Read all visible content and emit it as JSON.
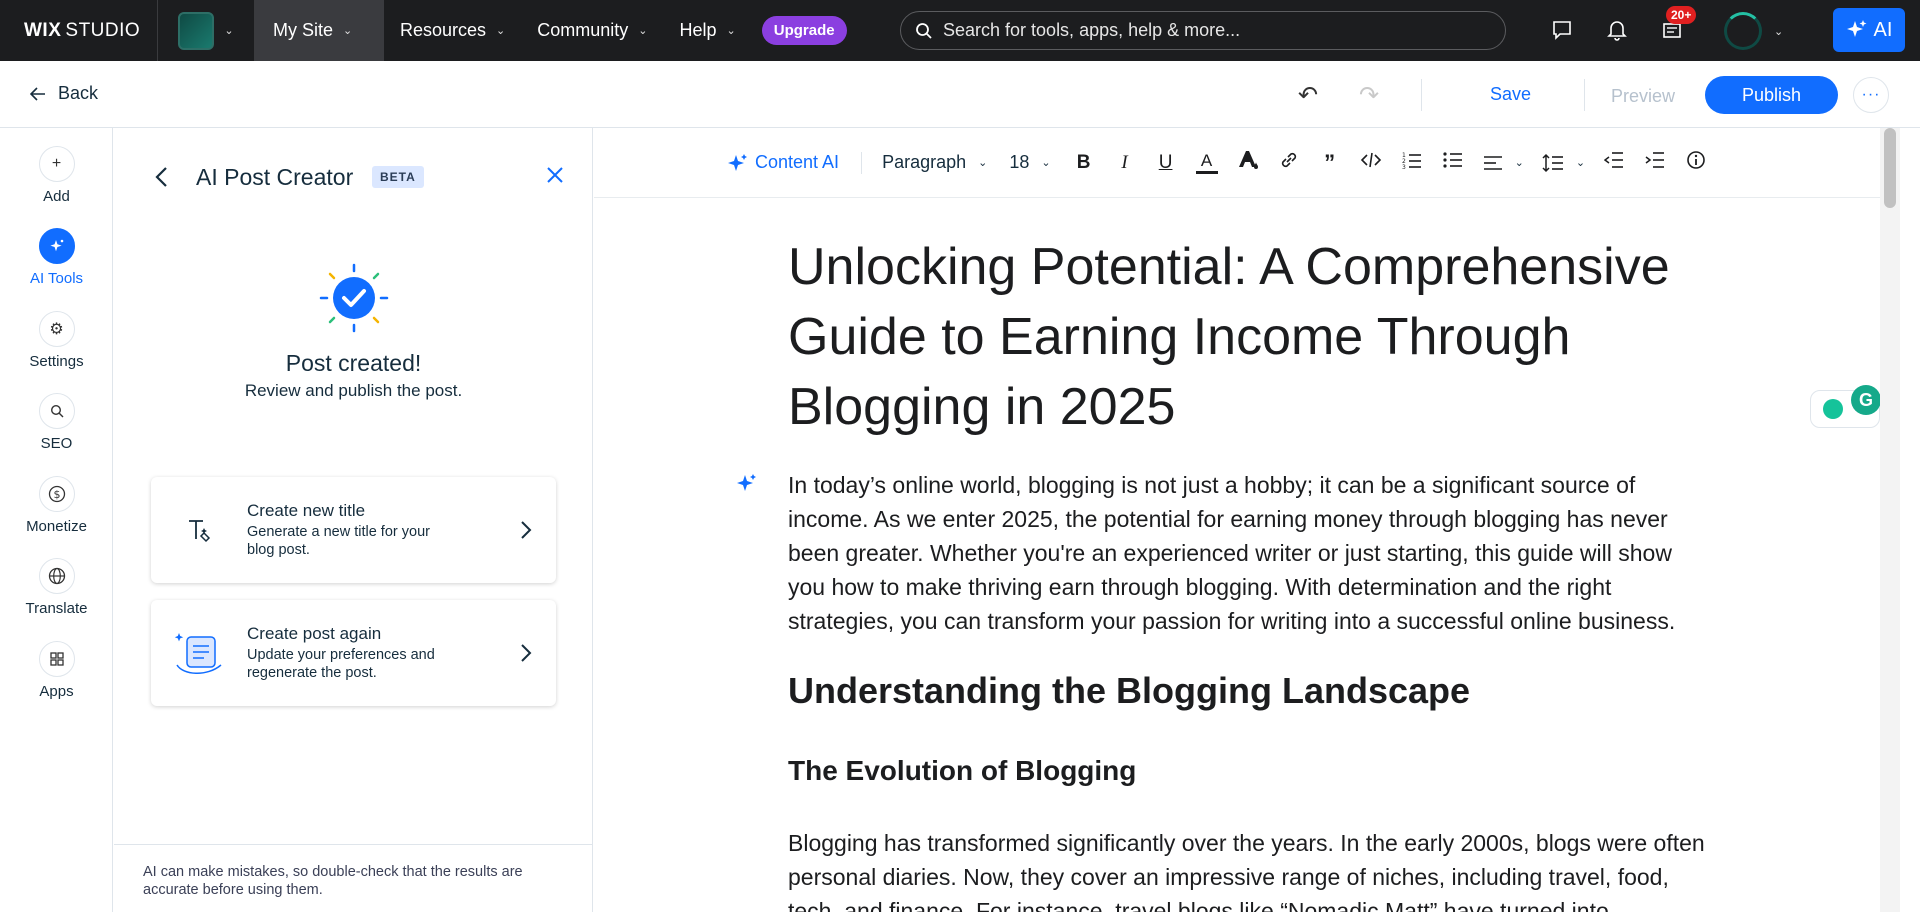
{
  "topbar": {
    "logo_main": "WIX",
    "logo_sub": "STUDIO",
    "nav": [
      {
        "label": "My Site"
      },
      {
        "label": "Resources"
      },
      {
        "label": "Community"
      },
      {
        "label": "Help"
      }
    ],
    "upgrade_label": "Upgrade",
    "search_placeholder": "Search for tools, apps, help & more...",
    "notification_badge": "20+",
    "ai_label": "AI"
  },
  "subbar": {
    "back_label": "Back",
    "save_label": "Save",
    "preview_label": "Preview",
    "publish_label": "Publish"
  },
  "rail": [
    {
      "label": "Add",
      "icon": "plus-icon"
    },
    {
      "label": "AI Tools",
      "icon": "sparkle-icon",
      "active": true
    },
    {
      "label": "Settings",
      "icon": "gear-icon"
    },
    {
      "label": "SEO",
      "icon": "search-icon"
    },
    {
      "label": "Monetize",
      "icon": "dollar-icon"
    },
    {
      "label": "Translate",
      "icon": "globe-icon"
    },
    {
      "label": "Apps",
      "icon": "apps-icon"
    }
  ],
  "panel": {
    "title": "AI Post Creator",
    "badge": "BETA",
    "success_title": "Post created!",
    "success_sub": "Review and publish the post.",
    "cards": [
      {
        "title": "Create new title",
        "desc": "Generate a new title for your blog post."
      },
      {
        "title": "Create post again",
        "desc": "Update your preferences and regenerate the post."
      }
    ],
    "footer": "AI can make mistakes, so double-check that the results are accurate before using them."
  },
  "toolbar": {
    "content_ai": "Content AI",
    "paragraph": "Paragraph",
    "font_size": "18"
  },
  "doc": {
    "title": "Unlocking Potential: A Comprehensive Guide to Earning Income Through Blogging in 2025",
    "intro": "In today’s online world, blogging is not just a hobby; it can be a significant source of income. As we enter 2025, the potential for earning money through blogging has never been greater. Whether you're an experienced writer or just starting, this guide will show you how to make thriving earn through blogging. With determination and the right strategies, you can transform your passion for writing into a successful online business.",
    "h2": "Understanding the Blogging Landscape",
    "h3": "The Evolution of Blogging",
    "para2": "Blogging has transformed significantly over the years. In the early 2000s, blogs were often personal diaries. Now, they cover an impressive range of niches, including travel, food, tech, and finance. For instance, travel blogs like “Nomadic Matt” have turned into"
  },
  "colors": {
    "accent": "#116dff",
    "topbar": "#1c1d1f",
    "upgrade": "#8b3fe0"
  }
}
